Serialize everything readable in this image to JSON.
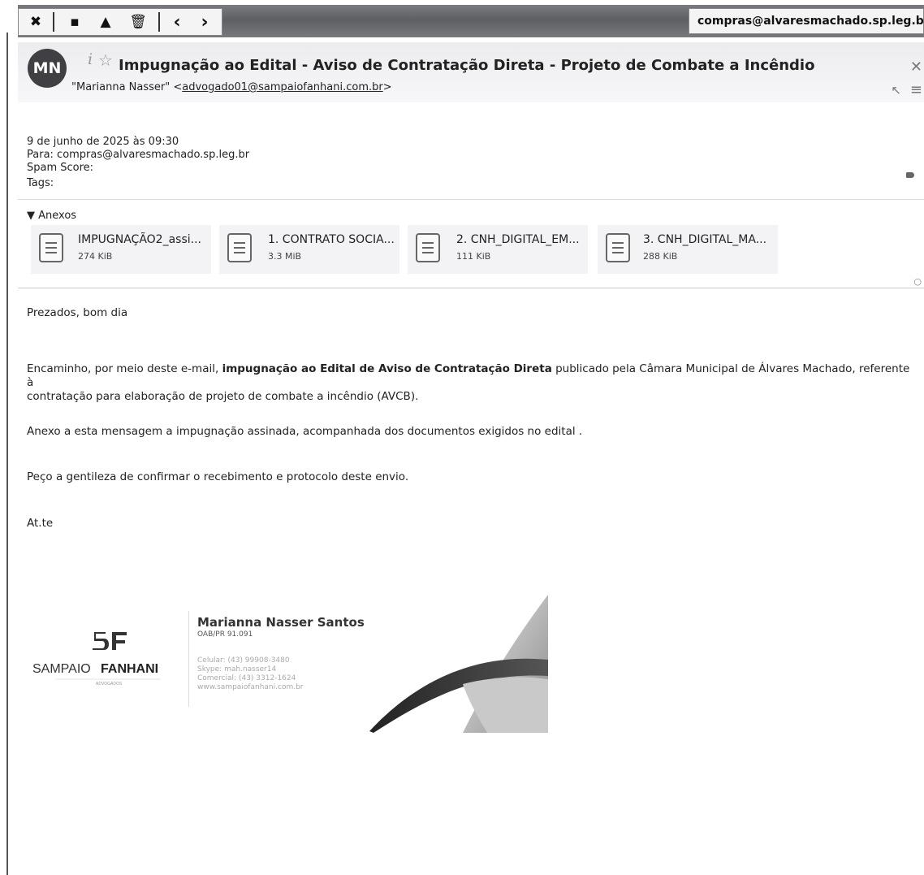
{
  "toolbar": {
    "buttons": [
      "✖",
      "▪",
      "▲",
      "🗑",
      "‹",
      "›"
    ],
    "account_email": "compras@alvaresmachado.sp.leg.br"
  },
  "header": {
    "avatar_initials": "MN",
    "subject": "Impugnação ao Edital - Aviso de Contratação Direta - Projeto de Combate a Incêndio",
    "from_name": "\"Marianna Nasser\" <",
    "from_email": "advogado01@sampaiofanhani.com.br",
    "from_close": ">"
  },
  "meta": {
    "date": "9 de junho de 2025 às 09:30",
    "to": "Para: compras@alvaresmachado.sp.leg.br",
    "spam": "Spam Score:",
    "tags": "Tags:"
  },
  "attachments": {
    "label": "▼ Anexos",
    "items": [
      {
        "name": "IMPUGNAÇÃO2_assi...",
        "size": "274 KiB"
      },
      {
        "name": "1. CONTRATO SOCIA...",
        "size": "3.3 MiB"
      },
      {
        "name": "2. CNH_DIGITAL_EM...",
        "size": "111 KiB"
      },
      {
        "name": "3. CNH_DIGITAL_MA...",
        "size": "288 KiB"
      }
    ]
  },
  "body": {
    "greeting": "Prezados, bom dia",
    "p1_a": "Encaminho, por meio deste e-mail, ",
    "p1_bold": "impugnação ao Edital de Aviso de Contratação Direta",
    "p1_b": " publicado pela Câmara Municipal de Álvares Machado, referente à",
    "p1_c": "contratação para elaboração de projeto de combate a incêndio (AVCB).",
    "p2": "Anexo a esta mensagem a impugnação assinada, acompanhada dos documentos exigidos no edital .",
    "p3": "Peço a gentileza de confirmar o recebimento e protocolo deste envio.",
    "closing": "At.te"
  },
  "signature": {
    "firm_left": "SAMPAIO",
    "firm_right": "FANHANI",
    "firm_sub": "ADVOGADOS",
    "name": "Marianna Nasser Santos",
    "oab": "OAB/PR 91.091",
    "celular": "Celular: (43) 99908-3480",
    "skype": "Skype: mah.nasser14",
    "comercial": "Comercial: (43) 3312-1624",
    "site": "www.sampaiofanhani.com.br"
  }
}
